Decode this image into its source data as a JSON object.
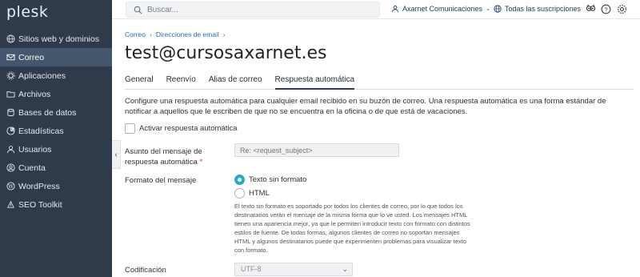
{
  "app": {
    "logo": "plesk"
  },
  "sidebar": {
    "items": [
      {
        "label": "Sitios web y dominios",
        "icon": "globe-icon",
        "active": false
      },
      {
        "label": "Correo",
        "icon": "mail-icon",
        "active": true
      },
      {
        "label": "Aplicaciones",
        "icon": "gear-icon",
        "active": false
      },
      {
        "label": "Archivos",
        "icon": "folder-icon",
        "active": false
      },
      {
        "label": "Bases de datos",
        "icon": "database-icon",
        "active": false
      },
      {
        "label": "Estadísticas",
        "icon": "chart-icon",
        "active": false
      },
      {
        "label": "Usuarios",
        "icon": "user-icon",
        "active": false
      },
      {
        "label": "Cuenta",
        "icon": "account-icon",
        "active": false
      },
      {
        "label": "WordPress",
        "icon": "wordpress-icon",
        "active": false
      },
      {
        "label": "SEO Toolkit",
        "icon": "seo-icon",
        "active": false
      }
    ]
  },
  "header": {
    "search_placeholder": "Buscar...",
    "account_label": "Axarnet Comunicaciones",
    "subscriptions_label": "Todas las suscripciones"
  },
  "breadcrumb": [
    "Correo",
    "Direcciones de email"
  ],
  "page_title": "test@cursosaxarnet.es",
  "tabs": [
    {
      "label": "General",
      "active": false
    },
    {
      "label": "Reenvío",
      "active": false
    },
    {
      "label": "Alias de correo",
      "active": false
    },
    {
      "label": "Respuesta automática",
      "active": true
    }
  ],
  "form": {
    "description": "Configure una respuesta automática para cualquier email recibido en su buzón de correo. Una respuesta automática es una forma estándar de notificar a aquellos que le escriben de que no se encuentra en la oficina o de que está de vacaciones.",
    "enable_label": "Activar respuesta automática",
    "enable_checked": false,
    "subject_label_line1": "Asunto del mensaje de",
    "subject_label_line2": "respuesta automática",
    "required_mark": "*",
    "subject_placeholder": "Re: <request_subject>",
    "format_label": "Formato del mensaje",
    "format_options": [
      {
        "label": "Texto sin formato",
        "selected": true
      },
      {
        "label": "HTML",
        "selected": false
      }
    ],
    "format_hint": "El texto sin formato es soportado por todos los clientes de correo, por lo que todos los destinatarios verán el mensaje de la misma forma que lo ve usted. Los mensajes HTML tienen una apariencia mejor, ya que le permiten introducir texto con formato con distintos estilos de fuente. De todas formas, algunos clientes de correo no soportan mensajes HTML y algunos destinatarios puede que experimenten problemas para visualizar texto con formato.",
    "encoding_label": "Codificación",
    "encoding_value": "UTF-8"
  },
  "colors": {
    "sidebar_bg": "#2f3b4b",
    "sidebar_active": "#44576c",
    "link": "#2b6cb0",
    "radio_accent": "#2fa7c6",
    "required": "#d0333a"
  }
}
